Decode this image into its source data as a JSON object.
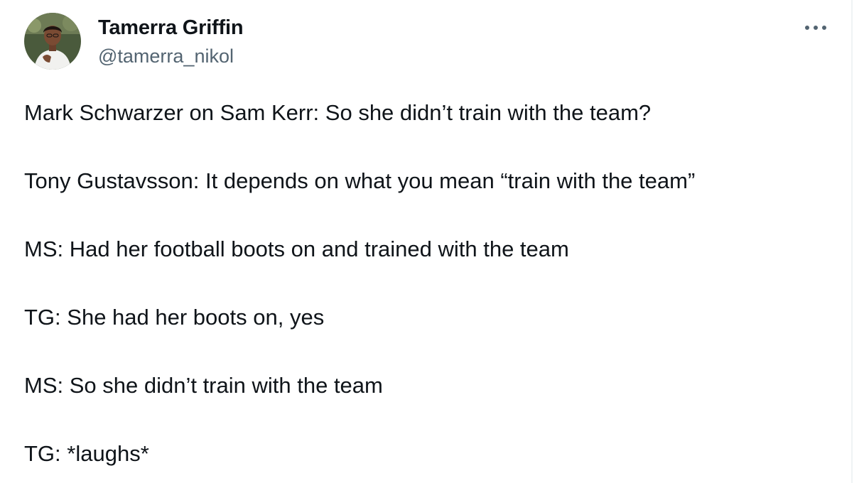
{
  "author": {
    "display_name": "Tamerra Griffin",
    "handle": "@tamerra_nikol",
    "avatar_icon": "profile-photo"
  },
  "more_icon": "more-options-icon",
  "colors": {
    "text": "#0f1419",
    "secondary_text": "#536471",
    "background": "#ffffff"
  },
  "tweet": {
    "lines": [
      "Mark Schwarzer on Sam Kerr: So she didn’t train with the team?",
      "Tony Gustavsson: It depends on what you mean “train with the team”",
      "MS: Had her football boots on and trained with the team",
      "TG: She had her boots on, yes",
      "MS: So she didn’t train with the team",
      "TG: *laughs*"
    ]
  }
}
